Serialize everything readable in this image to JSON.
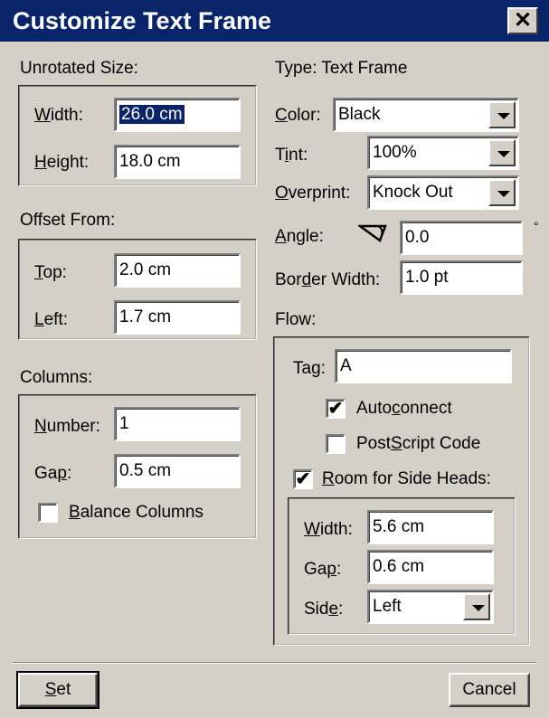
{
  "window": {
    "title": "Customize Text Frame",
    "close_label": "✕"
  },
  "unrotated_size": {
    "label": "Unrotated Size:",
    "width_label_u": "W",
    "width_label_rest": "idth:",
    "width_value": "26.0 cm",
    "height_label_u": "H",
    "height_label_rest": "eight:",
    "height_value": "18.0 cm"
  },
  "offset_from": {
    "label": "Offset From:",
    "top_label_u": "T",
    "top_label_rest": "op:",
    "top_value": "2.0 cm",
    "left_label_u": "L",
    "left_label_rest": "eft:",
    "left_value": "1.7 cm"
  },
  "columns": {
    "label": "Columns:",
    "number_label_u": "N",
    "number_label_rest": "umber:",
    "number_value": "1",
    "gap_label_pre": "Ga",
    "gap_label_u": "p",
    "gap_label_rest": ":",
    "gap_value": "0.5 cm",
    "balance_label_u": "B",
    "balance_label_rest": "alance Columns",
    "balance_checked": false
  },
  "type": {
    "label": "Type:",
    "value": "Text Frame"
  },
  "color": {
    "label_u": "C",
    "label_rest": "olor:",
    "value": "Black"
  },
  "tint": {
    "label_pre": "T",
    "label_u": "i",
    "label_rest": "nt:",
    "value": "100%"
  },
  "overprint": {
    "label_u": "O",
    "label_rest": "verprint:",
    "value": "Knock Out"
  },
  "angle": {
    "label_u": "A",
    "label_rest": "ngle:",
    "value": "0.0",
    "unit": "°"
  },
  "border_width": {
    "label_pre": "Bor",
    "label_u": "d",
    "label_rest": "er Width:",
    "value": "1.0 pt"
  },
  "flow": {
    "label": "Flow:",
    "tag_label_pre": "Ta",
    "tag_label_u": "g",
    "tag_label_rest": ":",
    "tag_value": "A",
    "autoconnect_pre": "Auto",
    "autoconnect_u": "c",
    "autoconnect_rest": "onnect",
    "autoconnect_checked": true,
    "postscript_pre": "Post",
    "postscript_u": "S",
    "postscript_rest": "cript Code",
    "postscript_checked": false,
    "room_u": "R",
    "room_rest": "oom for Side Heads:",
    "room_checked": true,
    "side_heads": {
      "width_label_u": "W",
      "width_label_rest": "idth:",
      "width_value": "5.6 cm",
      "gap_label_pre": "Ga",
      "gap_label_u": "p",
      "gap_label_rest": ":",
      "gap_value": "0.6 cm",
      "side_label_pre": "Sid",
      "side_label_u": "e",
      "side_label_rest": ":",
      "side_value": "Left"
    }
  },
  "buttons": {
    "set_u": "S",
    "set_rest": "et",
    "cancel": "Cancel"
  },
  "checkmark": "✔",
  "colors": {
    "titlebar": "#0a246a",
    "face": "#d4d0c8",
    "selection": "#0a246a"
  }
}
